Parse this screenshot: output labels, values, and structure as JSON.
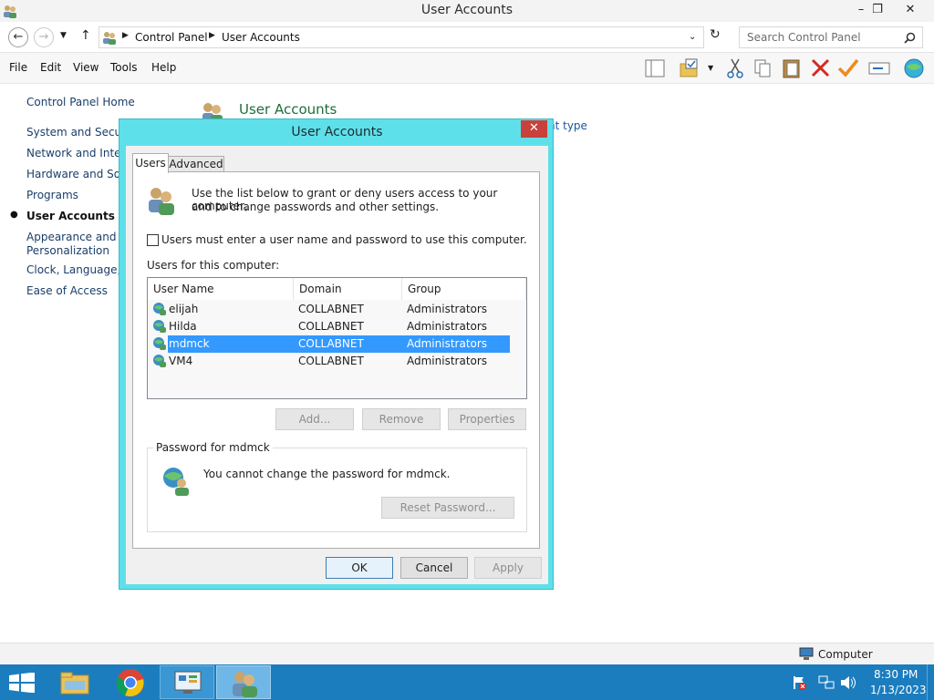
{
  "window": {
    "title": "User Accounts",
    "minimize": "–",
    "restore": "❐",
    "close": "✕"
  },
  "address_bar": {
    "crumbs": [
      "Control Panel",
      "User Accounts"
    ],
    "search_placeholder": "Search Control Panel"
  },
  "menu": [
    "File",
    "Edit",
    "View",
    "Tools",
    "Help"
  ],
  "toolbar_icons": [
    "layout-icon",
    "folder-check-icon",
    "cut-icon",
    "copy-icon",
    "paste-icon",
    "delete-icon",
    "properties-check-icon",
    "rename-icon",
    "globe-icon"
  ],
  "left_panel": {
    "home": "Control Panel Home",
    "links": [
      "System and Securit",
      "Network and Intern",
      "Hardware and Soun",
      "Programs",
      "User Accounts",
      "Appearance and\nPersonalization",
      "Clock, Language, a",
      "Ease of Access"
    ],
    "active": "User Accounts"
  },
  "main": {
    "title": "User Accounts",
    "partial_link": "nt type"
  },
  "dialog": {
    "title": "User Accounts",
    "tabs": [
      "Users",
      "Advanced"
    ],
    "intro_line1": "Use the list below to grant or deny users access to your computer,",
    "intro_line2": "and to change passwords and other settings.",
    "checkbox_label": "Users must enter a user name and password to use this computer.",
    "list_label": "Users for this computer:",
    "columns": [
      "User Name",
      "Domain",
      "Group"
    ],
    "users": [
      {
        "name": "elijah",
        "domain": "COLLABNET",
        "group": "Administrators"
      },
      {
        "name": "Hilda",
        "domain": "COLLABNET",
        "group": "Administrators"
      },
      {
        "name": "mdmck",
        "domain": "COLLABNET",
        "group": "Administrators"
      },
      {
        "name": "VM4",
        "domain": "COLLABNET",
        "group": "Administrators"
      }
    ],
    "selected_user": "mdmck",
    "buttons": {
      "add": "Add...",
      "remove": "Remove",
      "properties": "Properties"
    },
    "password_group_label": "Password for mdmck",
    "password_message": "You cannot change the password for mdmck.",
    "reset_password": "Reset Password...",
    "ok": "OK",
    "cancel": "Cancel",
    "apply": "Apply"
  },
  "status_bar": {
    "location": "Computer"
  },
  "taskbar": {
    "time": "8:30 PM",
    "date": "1/13/2023"
  },
  "colors": {
    "dialog_frame": "#5ee0ea",
    "selection": "#3399ff",
    "taskbar": "#1c7dbe",
    "link": "#1a3e6a",
    "main_title": "#1e6d3a"
  }
}
